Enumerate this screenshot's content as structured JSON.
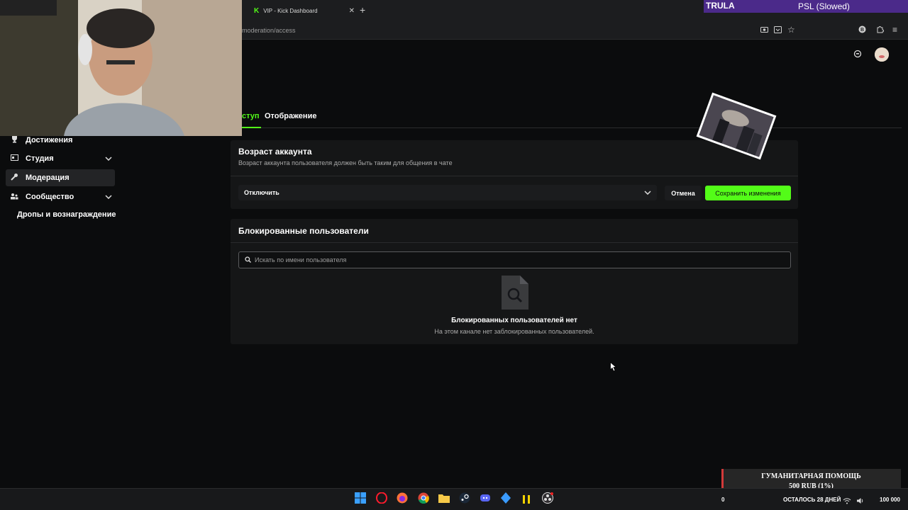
{
  "browser": {
    "tab_title": "VIP - Kick Dashboard",
    "tab_icon": "K",
    "new_tab": "+",
    "close": "✕",
    "url": "moderation/access"
  },
  "overlay": {
    "logo": "TRULA",
    "song": "PSL (Slowed)"
  },
  "tabs": {
    "access": "ступ",
    "display": "Отображение"
  },
  "sidebar": {
    "items": [
      {
        "label": "Достижения",
        "icon": "trophy-icon"
      },
      {
        "label": "Студия",
        "icon": "studio-icon"
      },
      {
        "label": "Модерация",
        "icon": "wrench-icon"
      },
      {
        "label": "Сообщество",
        "icon": "community-icon"
      }
    ],
    "drops": "Дропы и вознаграждение"
  },
  "account_age": {
    "title": "Возраст аккаунта",
    "description": "Возраст аккаунта пользователя должен быть таким для общения в чате",
    "selected": "Отключить",
    "cancel": "Отмена",
    "save": "Сохранить изменения"
  },
  "blocked": {
    "title": "Блокированные пользователи",
    "search_placeholder": "Искать по имени пользователя",
    "empty_title": "Блокированных пользователей нет",
    "empty_desc": "На этом канале нет заблокированных пользователей."
  },
  "donation": {
    "title": "ГУМАНИТАРНАЯ ПОМОЩЬ",
    "amount": "500 RUB (1%)",
    "start": "0",
    "remaining": "ОСТАЛОСЬ 28 ДНЕЙ",
    "goal": "100 000"
  },
  "colors": {
    "accent": "#53fc18",
    "background": "#0b0c0d",
    "card": "#151617"
  }
}
